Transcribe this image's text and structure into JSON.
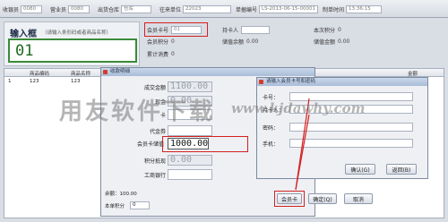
{
  "topbar": {
    "fields": [
      {
        "label": "收银员",
        "value": "0080"
      },
      {
        "label": "营业员",
        "value": "0080"
      },
      {
        "label": "出货仓库",
        "value": "仓库"
      },
      {
        "label": "往来单位",
        "value": "22023"
      },
      {
        "label": "单据编号",
        "value": "LS-2013-06-15-00001"
      },
      {
        "label": "制单时间",
        "value": "13:36:15"
      }
    ]
  },
  "input_panel": {
    "title": "输入框",
    "hint": "（请输入条形码或者商品名称）",
    "value": "01"
  },
  "info": {
    "member_card_label": "会员卡号",
    "member_card_value": "01",
    "cardholder_label": "持卡人",
    "times_label": "本次积分",
    "times_value": "0",
    "member_points_label": "会员积分",
    "member_points_value": "0",
    "stored_balance_label": "储值余额",
    "stored_balance_value": "0.00",
    "stored_points_label": "储值金额",
    "stored_points_value": "0.00",
    "total_consume_label": "累计消费",
    "total_consume_value": "0"
  },
  "grid": {
    "headers": [
      "商品编码",
      "商品名称",
      "",
      "金额"
    ],
    "rows": [
      {
        "index": "1",
        "code": "123",
        "name": "123",
        "extra": "5454"
      }
    ]
  },
  "dialog_pay": {
    "title": "收款明细",
    "rows": [
      {
        "label": "成交金额",
        "value": "1100.00"
      },
      {
        "label": "现金",
        "value": "0.00"
      },
      {
        "label": "卡",
        "value": ""
      },
      {
        "label": "代金券",
        "value": ""
      },
      {
        "label": "会员卡储值",
        "value": "1000.00"
      },
      {
        "label": "积分抵现",
        "value": "0.00"
      },
      {
        "label": "工商银行",
        "value": ""
      }
    ],
    "balance_text": "余额：100.00",
    "points_text": "本单积分",
    "points_value": "0",
    "buttons": {
      "member_card": "会员卡",
      "confirm": "确定(Q)",
      "cancel": "取消"
    }
  },
  "dialog_member": {
    "title": "请输入会员卡号和密码",
    "fields": [
      {
        "label": "卡号："
      },
      {
        "label": "持卡人："
      },
      {
        "label": "密码："
      },
      {
        "label": "手机："
      }
    ],
    "buttons": {
      "confirm": "确认(G)",
      "back": "返回(B)"
    }
  },
  "watermark": {
    "text": "用友软件下载",
    "url": "www.kjdawhy.com"
  }
}
